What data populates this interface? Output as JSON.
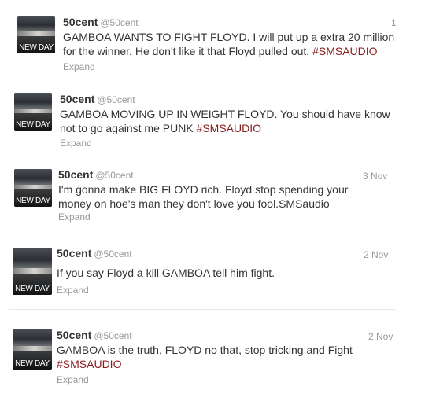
{
  "tweets": [
    {
      "avatar_label": "NEW DAY",
      "name": "50cent",
      "handle": "@50cent",
      "time": "1",
      "text": "GAMBOA WANTS TO FIGHT FLOYD. I will put up a extra 20 million for the winner. He don't like it that Floyd pulled out. ",
      "hashtag": "#SMSAUDIO",
      "expand": "Expand"
    },
    {
      "avatar_label": "NEW DAY",
      "name": "50cent",
      "handle": "@50cent",
      "time": "",
      "text": "GAMBOA MOVING UP IN WEIGHT FLOYD. You should have know not to go against me PUNK ",
      "hashtag": "#SMSAUDIO",
      "expand": "Expand"
    },
    {
      "avatar_label": "NEW DAY",
      "name": "50cent",
      "handle": "@50cent",
      "time": "3 Nov",
      "text": "I'm gonna make BIG FLOYD rich. Floyd stop spending your money on hoe's man they don't love you fool.SMSaudio",
      "hashtag": "",
      "expand": "Expand"
    },
    {
      "avatar_label": "NEW DAY",
      "name": "50cent",
      "handle": "@50cent",
      "time": "2 Nov",
      "text": "If you say Floyd a kill GAMBOA tell him fight.",
      "hashtag": "",
      "expand": "Expand"
    },
    {
      "avatar_label": "NEW DAY",
      "name": "50cent",
      "handle": "@50cent",
      "time": "2 Nov",
      "text": "GAMBOA is the truth, FLOYD no that, stop tricking and Fight ",
      "hashtag": "#SMSAUDIO",
      "expand": "Expand"
    }
  ]
}
